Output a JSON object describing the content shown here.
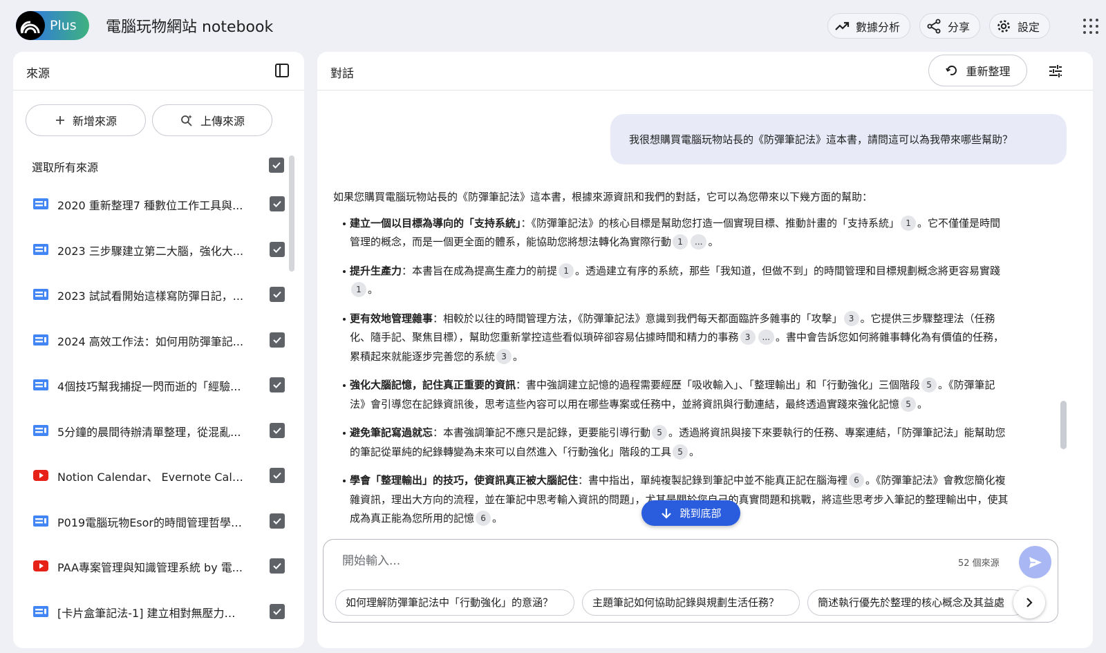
{
  "header": {
    "plan_badge": "Plus",
    "notebook_title": "電腦玩物網站 notebook",
    "analytics_label": "數據分析",
    "share_label": "分享",
    "settings_label": "設定"
  },
  "sources_panel": {
    "title": "來源",
    "add_source_label": "新增來源",
    "upload_source_label": "上傳來源",
    "select_all_label": "選取所有來源",
    "items": [
      {
        "label": "2020 重新整理7 種數位工作工具與...",
        "type": "document-icon"
      },
      {
        "label": "2023 三步驟建立第二大腦，強化大...",
        "type": "document-icon"
      },
      {
        "label": "2023 試試看開始這樣寫防彈日記，...",
        "type": "document-icon"
      },
      {
        "label": "2024 高效工作法：如何用防彈筆記...",
        "type": "document-icon"
      },
      {
        "label": "4個技巧幫我捕捉一閃而逝的「經驗...",
        "type": "document-icon"
      },
      {
        "label": "5分鐘的晨間待辦清單整理，從混亂...",
        "type": "document-icon"
      },
      {
        "label": "Notion Calendar、 Evernote Calen...",
        "type": "youtube-icon"
      },
      {
        "label": "P019電腦玩物Esor的時間管理哲學(...",
        "type": "document-icon"
      },
      {
        "label": "PAA專案管理與知識管理系統 by 電...",
        "type": "youtube-icon"
      },
      {
        "label": "[卡片盒筆記法-1] 建立相對無壓力、...",
        "type": "document-icon"
      }
    ]
  },
  "chat_panel": {
    "title": "對話",
    "regenerate_label": "重新整理",
    "user_message": "我很想購買電腦玩物站長的《防彈筆記法》這本書，請問這可以為我帶來哪些幫助？",
    "answer_intro": "如果您購買電腦玩物站長的《防彈筆記法》這本書，根據來源資訊和我們的對話，它可以為您帶來以下幾方面的幫助：",
    "answer_points": [
      {
        "title": "建立一個以目標為導向的「支持系統」",
        "t1": "：《防彈筆記法》的核心目標是幫助您打造一個實現目標、推動計畫的「支持系統」",
        "c1": "1",
        "t2": "。它不僅僅是時間管理的概念，而是一個更全面的體系，能協助您將想法轉化為實際行動",
        "c2": "1",
        "c3": "...",
        "t3": "。"
      },
      {
        "title": "提升生產力",
        "t1": "：本書旨在成為提高生產力的前提",
        "c1": "1",
        "t2": "。透過建立有序的系統，那些「我知道，但做不到」的時間管理和目標規劃概念將更容易實踐",
        "c2": "1",
        "t3": "。"
      },
      {
        "title": "更有效地管理雜事",
        "t1": "：相較於以往的時間管理方法，《防彈筆記法》意識到我們每天都面臨許多雜事的「攻擊」",
        "c1": "3",
        "t2": "。它提供三步驟整理法（任務化、隨手記、聚焦目標），幫助您重新掌控這些看似瑣碎卻容易佔據時間和精力的事務",
        "c2": "3",
        "c3": "...",
        "t3": "。書中會告訴您如何將雜事轉化為有價值的任務，累積起來就能逐步完善您的系統",
        "c4": "3",
        "t4": "。"
      },
      {
        "title": "強化大腦記憶，記住真正重要的資訊",
        "t1": "：書中強調建立記憶的過程需要經歷「吸收輸入」、「整理輸出」和「行動強化」三個階段",
        "c1": "5",
        "t2": "。《防彈筆記法》會引導您在記錄資訊後，思考這些內容可以用在哪些專案或任務中，並將資訊與行動連結，最終透過實踐來強化記憶",
        "c2": "5",
        "t3": "。"
      },
      {
        "title": "避免筆記寫過就忘",
        "t1": "：本書強調筆記不應只是記錄，更要能引導行動",
        "c1": "5",
        "t2": "。透過將資訊與接下來要執行的任務、專案連結，「防彈筆記法」能幫助您的筆記從單純的紀錄轉變為未來可以自然進入「行動強化」階段的工具",
        "c2": "5",
        "t3": "。"
      },
      {
        "title": "學會「整理輸出」的技巧，使資訊真正被大腦記住",
        "t1": "：書中指出，單純複製記錄到筆記中並不能真正記在腦海裡",
        "c1": "6",
        "t2": "。《防彈筆記法》會教您簡化複雜資訊，理出大方向的流程，並在筆記中思考輸入資訊的問題」，尤其是關於您自己的真實問題和挑戰，將這些思考步入筆記的整理輸出中，使其成為真正能為您所用的記憶",
        "c2": "6",
        "t3": "。"
      }
    ],
    "jump_to_bottom_label": "跳到底部",
    "input_placeholder": "開始輸入...",
    "source_count": "52 個來源",
    "suggestions": [
      "如何理解防彈筆記法中「行動強化」的意涵？",
      "主題筆記如何協助記錄與規劃生活任務？",
      "簡述執行優先於整理的核心概念及其益處"
    ]
  },
  "colors": {
    "accent_blue": "#2a5dde",
    "send_button": "#a9b8f4",
    "user_bubble": "#e8ebf7",
    "youtube_red": "#e62117",
    "doc_blue": "#4285f4"
  }
}
